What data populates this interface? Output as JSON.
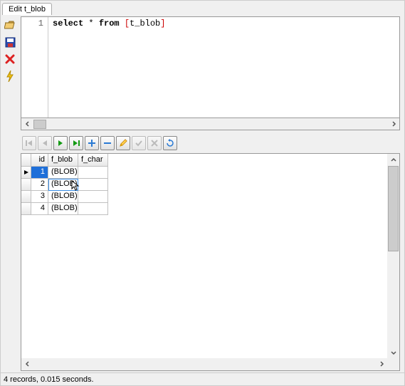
{
  "tab": {
    "label": "Edit t_blob"
  },
  "editor": {
    "line_number": "1",
    "sql_kw_select": "select",
    "sql_star": "*",
    "sql_kw_from": "from",
    "sql_bracket_open": "[",
    "sql_table": "t_blob",
    "sql_bracket_close": "]"
  },
  "nav": {
    "first": "first-record",
    "prev": "prev-record",
    "next": "next-record",
    "last": "last-record",
    "add": "add-record",
    "delete": "delete-record",
    "edit": "edit-record",
    "post": "post-record",
    "cancel": "cancel-record",
    "refresh": "refresh-records"
  },
  "grid": {
    "columns": {
      "id": "id",
      "f_blob": "f_blob",
      "f_char": "f_char"
    },
    "rows": [
      {
        "indicator": "▶",
        "id": "1",
        "f_blob": "(BLOB)",
        "f_char": "",
        "current": true,
        "selected_cell": "id"
      },
      {
        "indicator": "",
        "id": "2",
        "f_blob": "(BLOB)",
        "f_char": "",
        "hover_cell": "f_blob"
      },
      {
        "indicator": "",
        "id": "3",
        "f_blob": "(BLOB)",
        "f_char": ""
      },
      {
        "indicator": "",
        "id": "4",
        "f_blob": "(BLOB)",
        "f_char": ""
      }
    ]
  },
  "status": {
    "text": "4 records, 0.015 seconds."
  }
}
